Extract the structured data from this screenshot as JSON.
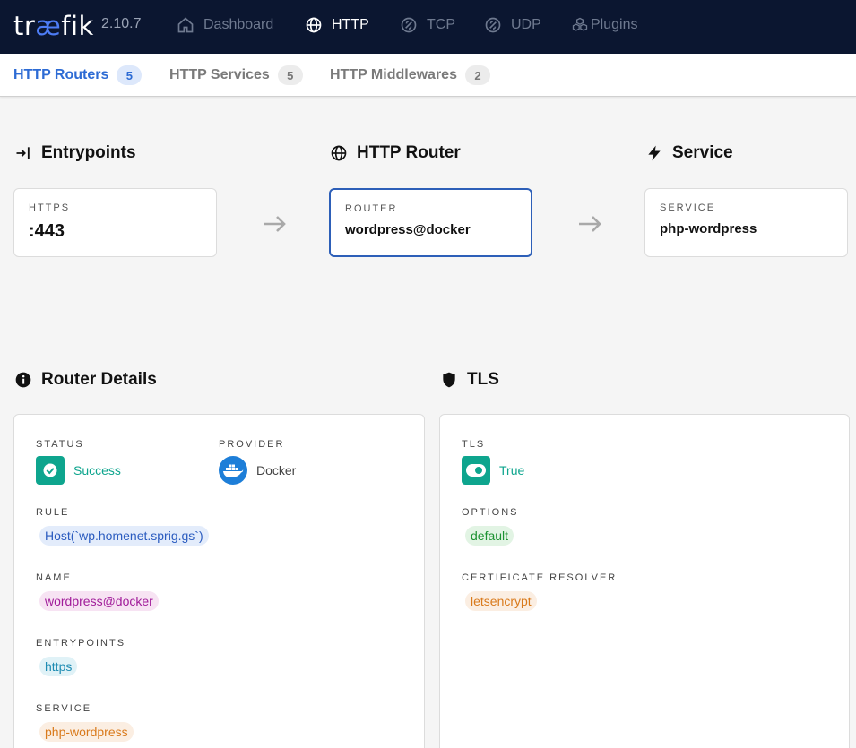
{
  "app": {
    "logo_pre": "tr",
    "logo_ae": "æ",
    "logo_post": "fik",
    "version": "2.10.7"
  },
  "nav": {
    "dashboard": "Dashboard",
    "http": "HTTP",
    "tcp": "TCP",
    "udp": "UDP",
    "plugins": "Plugins"
  },
  "subnav": {
    "routers": {
      "label": "HTTP Routers",
      "count": "5"
    },
    "services": {
      "label": "HTTP Services",
      "count": "5"
    },
    "middlewares": {
      "label": "HTTP Middlewares",
      "count": "2"
    }
  },
  "flow": {
    "entrypoints_title": "Entrypoints",
    "router_title": "HTTP Router",
    "service_title": "Service",
    "entry_caption": "HTTPS",
    "entry_value": ":443",
    "router_caption": "ROUTER",
    "router_value": "wordpress@docker",
    "service_caption": "SERVICE",
    "service_value": "php-wordpress"
  },
  "details": {
    "title": "Router Details",
    "status_label": "STATUS",
    "status_value": "Success",
    "provider_label": "PROVIDER",
    "provider_value": "Docker",
    "rule_label": "RULE",
    "rule_value": "Host(`wp.homenet.sprig.gs`)",
    "name_label": "NAME",
    "name_value": "wordpress@docker",
    "entrypoints_label": "ENTRYPOINTS",
    "entrypoints_value": "https",
    "service_label": "SERVICE",
    "service_value": "php-wordpress"
  },
  "tls": {
    "title": "TLS",
    "tls_label": "TLS",
    "tls_value": "True",
    "options_label": "OPTIONS",
    "options_value": "default",
    "resolver_label": "CERTIFICATE RESOLVER",
    "resolver_value": "letsencrypt"
  },
  "colors": {
    "topbar": "#0b1630",
    "accent": "#2d6bd4",
    "success": "#0ea58e"
  }
}
